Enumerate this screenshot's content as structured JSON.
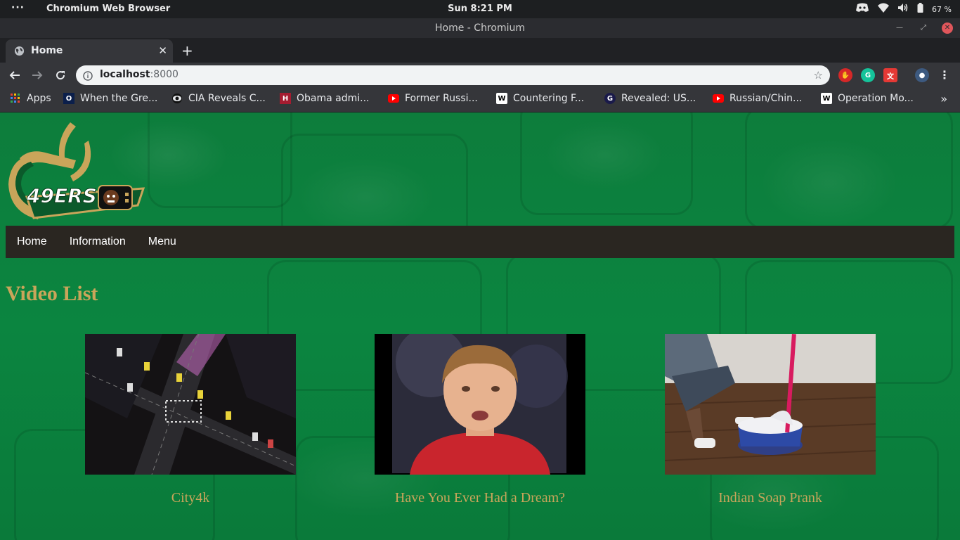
{
  "os_bar": {
    "app_name": "Chromium Web Browser",
    "clock": "Sun  8:21 PM",
    "battery": "67 %"
  },
  "window": {
    "title": "Home - Chromium"
  },
  "tabs": [
    {
      "title": "Home"
    }
  ],
  "omnibox": {
    "host": "localhost",
    "port": ":8000"
  },
  "bookmarks": {
    "apps_label": "Apps",
    "items": [
      {
        "label": "When the Gre...",
        "icon": "o-favicon"
      },
      {
        "label": "CIA Reveals C...",
        "icon": "cbs-favicon"
      },
      {
        "label": "Obama admi...",
        "icon": "harvard-favicon"
      },
      {
        "label": "Former Russi...",
        "icon": "youtube-favicon"
      },
      {
        "label": "Countering F...",
        "icon": "wikipedia-favicon"
      },
      {
        "label": "Revealed: US...",
        "icon": "guardian-favicon"
      },
      {
        "label": "Russian/Chin...",
        "icon": "youtube-favicon"
      },
      {
        "label": "Operation Mo...",
        "icon": "wikipedia-favicon"
      }
    ]
  },
  "site": {
    "logo_text": "49ERS",
    "nav": [
      "Home",
      "Information",
      "Menu"
    ],
    "heading": "Video List",
    "videos": [
      {
        "title": "City4k"
      },
      {
        "title": "Have You Ever Had a Dream?"
      },
      {
        "title": "Indian Soap Prank"
      }
    ]
  },
  "colors": {
    "page_bg": "#0b8540",
    "nav_bg": "#2a2621",
    "heading_gold": "#c9a55a"
  }
}
